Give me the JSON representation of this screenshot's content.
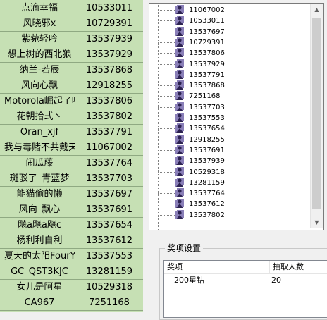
{
  "sheet": {
    "rows": [
      {
        "name": "点滴幸福",
        "id": "10533011"
      },
      {
        "name": "风晓邪x",
        "id": "10729391"
      },
      {
        "name": "紫菀轻吟",
        "id": "13537939"
      },
      {
        "name": "想上树的西北狼",
        "id": "13537929"
      },
      {
        "name": "纳兰-若辰",
        "id": "13537868"
      },
      {
        "name": "风向心飘",
        "id": "12918255"
      },
      {
        "name": "Motorola崛起了吗",
        "id": "13537806"
      },
      {
        "name": "花朝拾弍丶",
        "id": "13537802"
      },
      {
        "name": "Oran_xjf",
        "id": "13537791"
      },
      {
        "name": "我与毒赌不共戴天",
        "id": "11067002"
      },
      {
        "name": "闹瓜藤",
        "id": "13537764"
      },
      {
        "name": "斑驳了_青蓝梦",
        "id": "13537703"
      },
      {
        "name": "能猫偷的懒",
        "id": "13537697"
      },
      {
        "name": "风向_飘心",
        "id": "13537691"
      },
      {
        "name": "飚a飚a飚c",
        "id": "13537654"
      },
      {
        "name": "杨利利自利",
        "id": "13537612"
      },
      {
        "name": "夏天的太阳FourYou",
        "id": "13537553"
      },
      {
        "name": "GC_QST3KJC",
        "id": "13281159"
      },
      {
        "name": "女儿是阿星",
        "id": "10529318"
      },
      {
        "name": "CA967",
        "id": "7251168"
      }
    ]
  },
  "tree": {
    "icon": "user-node-icon",
    "items": [
      "11067002",
      "10533011",
      "13537697",
      "10729391",
      "13537806",
      "13537929",
      "13537791",
      "13537868",
      "7251168",
      "13537703",
      "13537553",
      "13537654",
      "12918255",
      "13537691",
      "13537939",
      "10529318",
      "13281159",
      "13537764",
      "13537612",
      "13537802"
    ]
  },
  "prize_settings": {
    "title": "奖项设置",
    "columns": [
      "奖项",
      "抽取人数"
    ],
    "rows": [
      {
        "prize": "200星钻",
        "count": "20"
      }
    ]
  },
  "colors": {
    "sheet_bg": "#c6e0b4",
    "grid": "#8fa982",
    "window_bg": "#f0f0f0"
  }
}
